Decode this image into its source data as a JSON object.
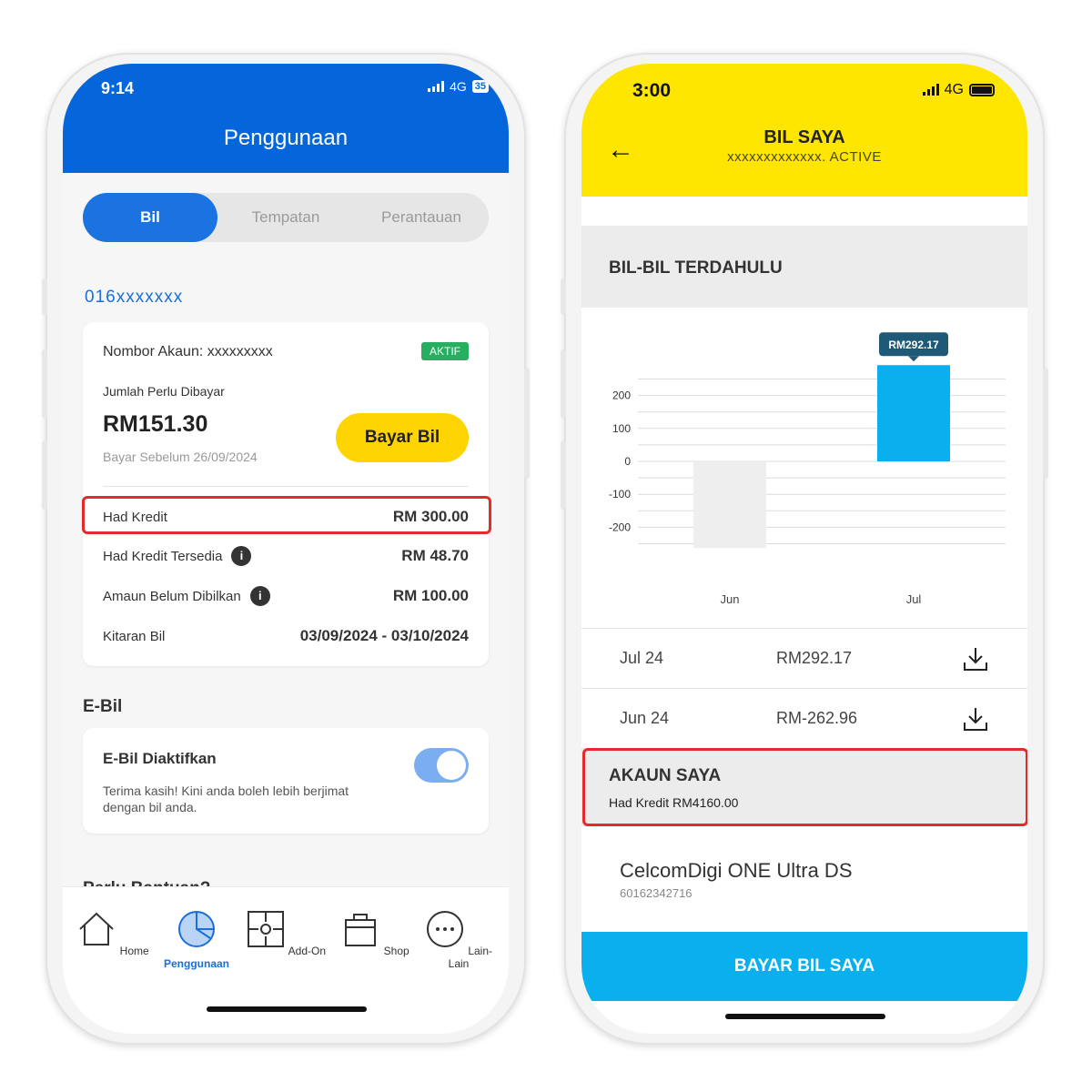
{
  "left": {
    "status": {
      "time": "9:14",
      "network": "4G",
      "battery": "35"
    },
    "header": {
      "title": "Penggunaan"
    },
    "segments": [
      {
        "label": "Bil",
        "active": true
      },
      {
        "label": "Tempatan",
        "active": false
      },
      {
        "label": "Perantauan",
        "active": false
      }
    ],
    "msisdn": "016xxxxxxx",
    "account_card": {
      "account_label": "Nombor Akaun: xxxxxxxxx",
      "status_badge": "AKTIF",
      "amount_label": "Jumlah Perlu Dibayar",
      "amount": "RM151.30",
      "due_text": "Bayar Sebelum 26/09/2024",
      "pay_button": "Bayar Bil",
      "rows": [
        {
          "label": "Had Kredit",
          "value": "RM 300.00"
        },
        {
          "label": "Had Kredit Tersedia",
          "value": "RM 48.70"
        },
        {
          "label": "Amaun Belum Dibilkan",
          "value": "RM 100.00"
        },
        {
          "label": "Kitaran Bil",
          "value": "03/09/2024 - 03/10/2024"
        }
      ],
      "info_glyph": "i"
    },
    "ebill": {
      "section_title": "E-Bil",
      "title": "E-Bil Diaktifkan",
      "description": "Terima kasih! Kini anda boleh lebih berjimat dengan bil anda.",
      "toggle_on": true
    },
    "cut_text": "Perlu Bantuan?",
    "tabbar": [
      {
        "label": "Home",
        "icon": "home-icon",
        "active": false
      },
      {
        "label": "Penggunaan",
        "icon": "pie-chart-icon",
        "active": true
      },
      {
        "label": "Add-On",
        "icon": "puzzle-icon",
        "active": false
      },
      {
        "label": "Shop",
        "icon": "shopping-bag-icon",
        "active": false
      },
      {
        "label": "Lain-Lain",
        "icon": "more-icon",
        "active": false
      }
    ]
  },
  "right": {
    "status": {
      "time": "3:00",
      "network": "4G"
    },
    "header": {
      "back_glyph": "←",
      "title": "BIL SAYA",
      "subtitle": "xxxxxxxxxxxxx. ACTIVE"
    },
    "past_bills_title": "BIL-BIL TERDAHULU",
    "chart_data": {
      "type": "bar",
      "categories": [
        "Jun",
        "Jul"
      ],
      "values": [
        -262.96,
        292.17
      ],
      "yticks": [
        200,
        100,
        0,
        -100,
        -200
      ],
      "ylim": [
        -260,
        250
      ],
      "tooltip": "RM292.17",
      "colors": {
        "negative": "#eeeeee",
        "positive": "#0ab0ee"
      }
    },
    "bills": [
      {
        "month": "Jul 24",
        "amount": "RM292.17"
      },
      {
        "month": "Jun 24",
        "amount": "RM-262.96"
      }
    ],
    "account": {
      "title": "AKAUN SAYA",
      "credit_limit": "Had Kredit RM4160.00"
    },
    "plan": {
      "name": "CelcomDigi ONE Ultra DS",
      "number": "60162342716"
    },
    "pay_button": "BAYAR BIL SAYA"
  },
  "colors": {
    "left_header": "#0566dc",
    "right_header": "#ffe600",
    "accent_blue": "#0ab0ee",
    "highlight": "#e32b2b"
  }
}
